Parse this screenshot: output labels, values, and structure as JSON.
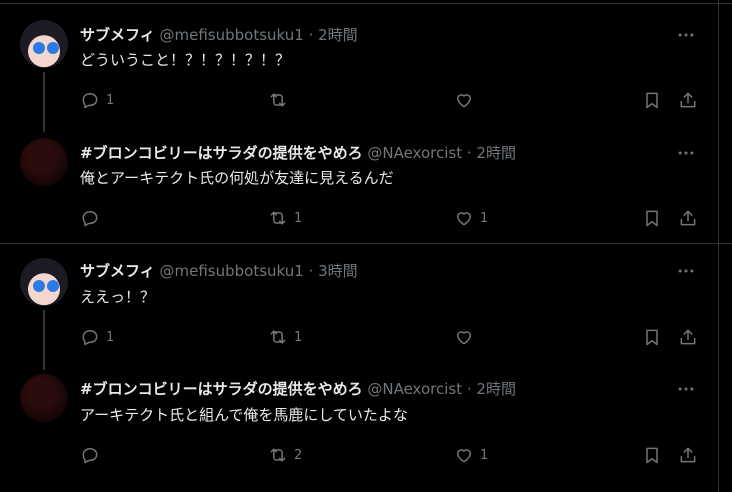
{
  "tweets": [
    {
      "name": "サブメフィ",
      "handle": "@mefisubbotsuku1",
      "time": "· 2時間",
      "text": "どういうこと！？！？！？！？",
      "reply_count": "1",
      "retweet_count": "",
      "like_count": "",
      "avatar": "anime-girl-avatar"
    },
    {
      "name": "#ブロンコビリーはサラダの提供をやめろ",
      "handle": "@NAexorcist",
      "time": "· 2時間",
      "text": "俺とアーキテクト氏の何処が友達に見えるんだ",
      "reply_count": "",
      "retweet_count": "1",
      "like_count": "1",
      "avatar": "dark-avatar"
    },
    {
      "name": "サブメフィ",
      "handle": "@mefisubbotsuku1",
      "time": "· 3時間",
      "text": "ええっ！？",
      "reply_count": "1",
      "retweet_count": "1",
      "like_count": "",
      "avatar": "anime-girl-avatar"
    },
    {
      "name": "#ブロンコビリーはサラダの提供をやめろ",
      "handle": "@NAexorcist",
      "time": "· 2時間",
      "text": "アーキテクト氏と組んで俺を馬鹿にしていたよな",
      "reply_count": "",
      "retweet_count": "2",
      "like_count": "1",
      "avatar": "dark-avatar"
    }
  ],
  "colors": {
    "background": "#000000",
    "text": "#e7e9ea",
    "muted": "#71767b",
    "border": "#2f3336"
  }
}
